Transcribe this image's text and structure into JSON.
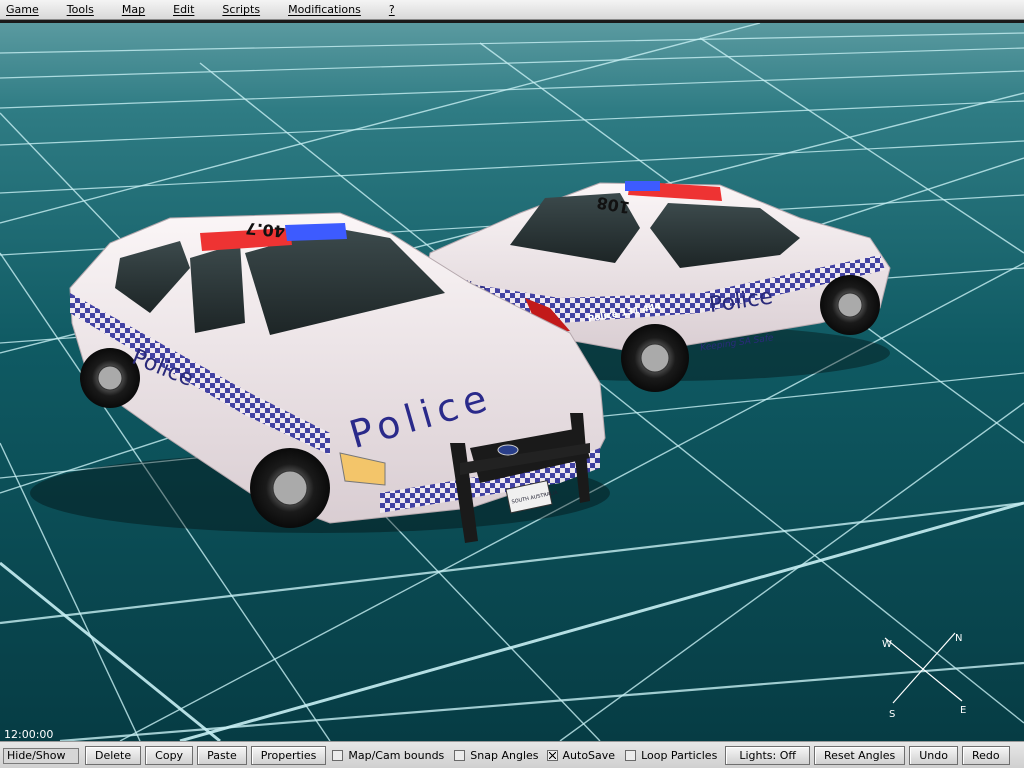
{
  "menu": {
    "items": [
      {
        "label": "Game"
      },
      {
        "label": "Tools"
      },
      {
        "label": "Map"
      },
      {
        "label": "Edit"
      },
      {
        "label": "Scripts"
      },
      {
        "label": "Modifications"
      },
      {
        "label": "?"
      }
    ]
  },
  "viewport": {
    "background_color": "#0d4a52",
    "grid_color": "#bfe9ef",
    "clock": "12:00:00",
    "compass": {
      "north": "N",
      "east": "E",
      "south": "S",
      "west": "W"
    },
    "vehicles": [
      {
        "name": "police-car-front",
        "body_text": "Police",
        "roof_number": "40.7",
        "plate_text": "SOUTH AUSTRALIA"
      },
      {
        "name": "police-car-rear",
        "body_text": "Police",
        "side_phone": "Police 131 444",
        "slogan": "Keeping SA Safe",
        "roof_number": "108"
      }
    ]
  },
  "toolbar": {
    "hide_show": "Hide/Show",
    "delete": "Delete",
    "copy": "Copy",
    "paste": "Paste",
    "properties": "Properties",
    "map_cam_bounds": "Map/Cam bounds",
    "snap_angles": "Snap Angles",
    "autosave": "AutoSave",
    "loop_particles": "Loop Particles",
    "lights": "Lights: Off",
    "reset_angles": "Reset Angles",
    "undo": "Undo",
    "redo": "Redo",
    "checks": {
      "map_cam_bounds": false,
      "snap_angles": false,
      "autosave": true,
      "loop_particles": false
    }
  }
}
